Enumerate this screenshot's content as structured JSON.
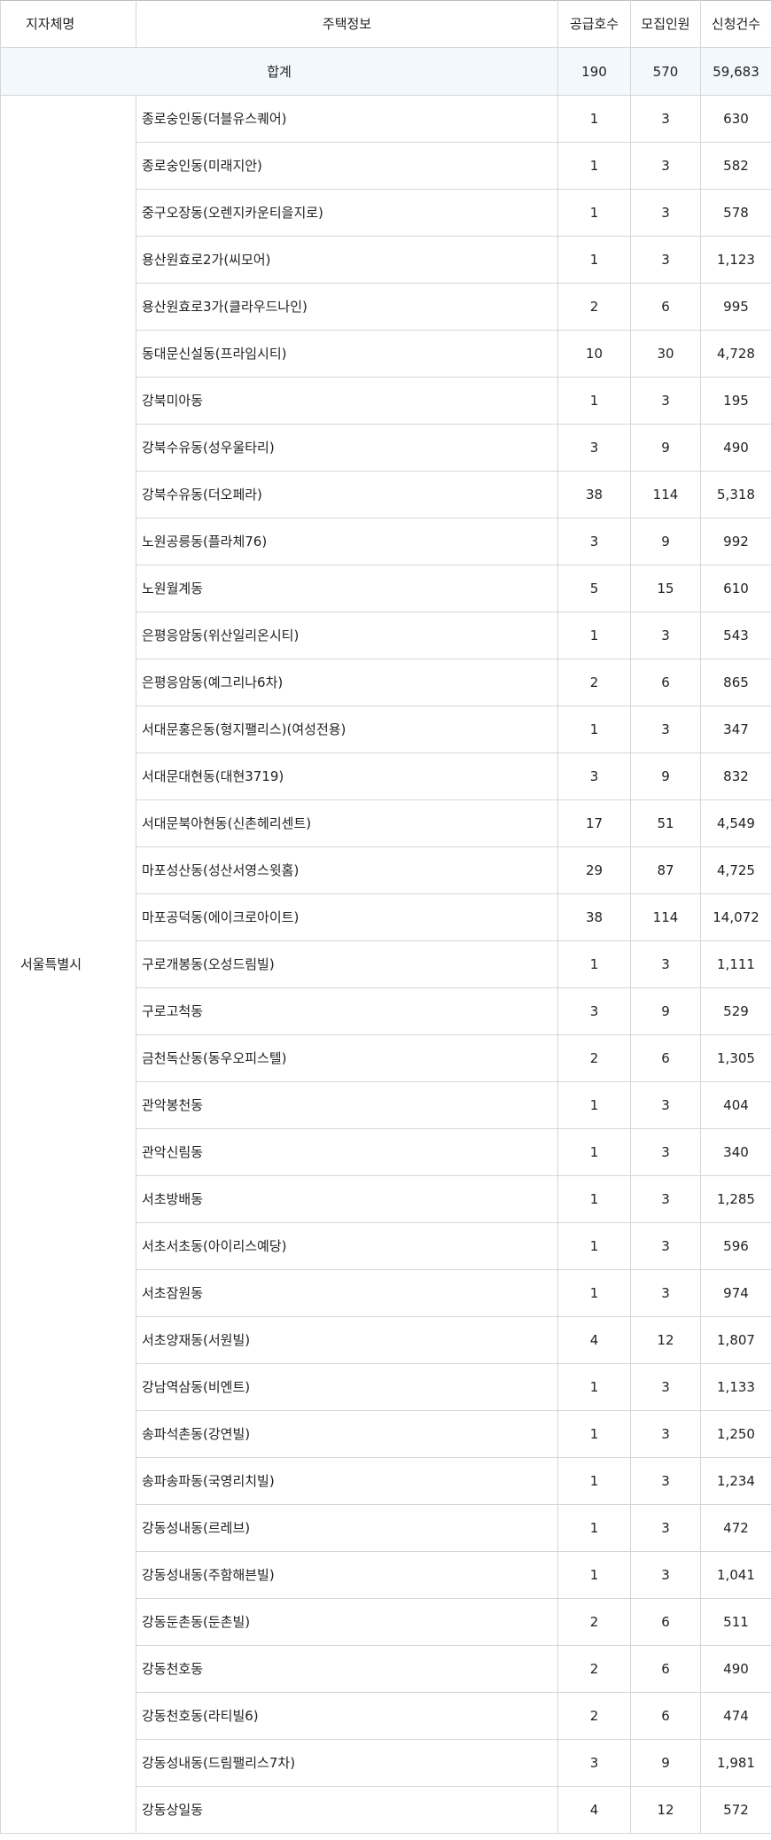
{
  "table": {
    "headers": {
      "region": "지자체명",
      "housing": "주택정보",
      "supply": "공급호수",
      "recruit": "모집인원",
      "applications": "신청건수"
    },
    "total": {
      "label": "합계",
      "supply": "190",
      "recruit": "570",
      "applications": "59,683"
    },
    "region_name": "서울특별시",
    "rows": [
      {
        "housing": "종로숭인동(더블유스퀘어)",
        "supply": "1",
        "recruit": "3",
        "applications": "630"
      },
      {
        "housing": "종로숭인동(미래지안)",
        "supply": "1",
        "recruit": "3",
        "applications": "582"
      },
      {
        "housing": "중구오장동(오렌지카운티을지로)",
        "supply": "1",
        "recruit": "3",
        "applications": "578"
      },
      {
        "housing": "용산원효로2가(씨모어)",
        "supply": "1",
        "recruit": "3",
        "applications": "1,123"
      },
      {
        "housing": "용산원효로3가(클라우드나인)",
        "supply": "2",
        "recruit": "6",
        "applications": "995"
      },
      {
        "housing": "동대문신설동(프라임시티)",
        "supply": "10",
        "recruit": "30",
        "applications": "4,728"
      },
      {
        "housing": "강북미아동",
        "supply": "1",
        "recruit": "3",
        "applications": "195"
      },
      {
        "housing": "강북수유동(성우울타리)",
        "supply": "3",
        "recruit": "9",
        "applications": "490"
      },
      {
        "housing": "강북수유동(더오페라)",
        "supply": "38",
        "recruit": "114",
        "applications": "5,318"
      },
      {
        "housing": "노원공릉동(플라체76)",
        "supply": "3",
        "recruit": "9",
        "applications": "992"
      },
      {
        "housing": "노원월계동",
        "supply": "5",
        "recruit": "15",
        "applications": "610"
      },
      {
        "housing": "은평응암동(위산일리온시티)",
        "supply": "1",
        "recruit": "3",
        "applications": "543"
      },
      {
        "housing": "은평응암동(예그리나6차)",
        "supply": "2",
        "recruit": "6",
        "applications": "865"
      },
      {
        "housing": "서대문홍은동(형지팰리스)(여성전용)",
        "supply": "1",
        "recruit": "3",
        "applications": "347"
      },
      {
        "housing": "서대문대현동(대현3719)",
        "supply": "3",
        "recruit": "9",
        "applications": "832"
      },
      {
        "housing": "서대문북아현동(신촌헤리센트)",
        "supply": "17",
        "recruit": "51",
        "applications": "4,549"
      },
      {
        "housing": "마포성산동(성산서영스윗홈)",
        "supply": "29",
        "recruit": "87",
        "applications": "4,725"
      },
      {
        "housing": "마포공덕동(에이크로아이트)",
        "supply": "38",
        "recruit": "114",
        "applications": "14,072"
      },
      {
        "housing": "구로개봉동(오성드림빌)",
        "supply": "1",
        "recruit": "3",
        "applications": "1,111"
      },
      {
        "housing": "구로고척동",
        "supply": "3",
        "recruit": "9",
        "applications": "529"
      },
      {
        "housing": "금천독산동(동우오피스텔)",
        "supply": "2",
        "recruit": "6",
        "applications": "1,305"
      },
      {
        "housing": "관악봉천동",
        "supply": "1",
        "recruit": "3",
        "applications": "404"
      },
      {
        "housing": "관악신림동",
        "supply": "1",
        "recruit": "3",
        "applications": "340"
      },
      {
        "housing": "서초방배동",
        "supply": "1",
        "recruit": "3",
        "applications": "1,285"
      },
      {
        "housing": "서초서초동(아이리스예당)",
        "supply": "1",
        "recruit": "3",
        "applications": "596"
      },
      {
        "housing": "서초잠원동",
        "supply": "1",
        "recruit": "3",
        "applications": "974"
      },
      {
        "housing": "서초양재동(서원빌)",
        "supply": "4",
        "recruit": "12",
        "applications": "1,807"
      },
      {
        "housing": "강남역삼동(비엔트)",
        "supply": "1",
        "recruit": "3",
        "applications": "1,133"
      },
      {
        "housing": "송파석촌동(강연빌)",
        "supply": "1",
        "recruit": "3",
        "applications": "1,250"
      },
      {
        "housing": "송파송파동(국영리치빌)",
        "supply": "1",
        "recruit": "3",
        "applications": "1,234"
      },
      {
        "housing": "강동성내동(르레브)",
        "supply": "1",
        "recruit": "3",
        "applications": "472"
      },
      {
        "housing": "강동성내동(주함해븐빌)",
        "supply": "1",
        "recruit": "3",
        "applications": "1,041"
      },
      {
        "housing": "강동둔촌동(둔촌빌)",
        "supply": "2",
        "recruit": "6",
        "applications": "511"
      },
      {
        "housing": "강동천호동",
        "supply": "2",
        "recruit": "6",
        "applications": "490"
      },
      {
        "housing": "강동천호동(라티빌6)",
        "supply": "2",
        "recruit": "6",
        "applications": "474"
      },
      {
        "housing": "강동성내동(드림팰리스7차)",
        "supply": "3",
        "recruit": "9",
        "applications": "1,981"
      },
      {
        "housing": "강동상일동",
        "supply": "4",
        "recruit": "12",
        "applications": "572"
      }
    ]
  }
}
